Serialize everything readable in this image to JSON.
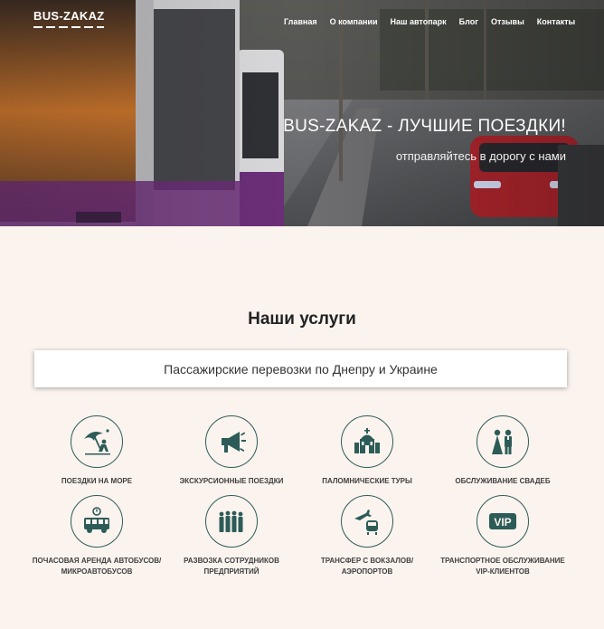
{
  "header": {
    "logo": "BUS-ZAKAZ",
    "nav": [
      "Главная",
      "О компании",
      "Наш автопарк",
      "Блог",
      "Отзывы",
      "Контакты"
    ]
  },
  "hero": {
    "title": "BUS-ZAKAZ - ЛУЧШИЕ ПОЕЗДКИ!",
    "subtitle": "отправляйтесь в дорогу с нами"
  },
  "services": {
    "title": "Наши услуги",
    "banner": "Пассажирские перевозки по Днепру и Украине",
    "items": [
      {
        "label": "ПОЕЗДКИ НА МОРЕ",
        "icon": "beach-umbrella-icon"
      },
      {
        "label": "ЭКСКУРСИОННЫЕ ПОЕЗДКИ",
        "icon": "megaphone-icon"
      },
      {
        "label": "ПАЛОМНИЧЕСКИЕ ТУРЫ",
        "icon": "church-icon"
      },
      {
        "label": "ОБСЛУЖИВАНИЕ СВАДЕБ",
        "icon": "wedding-couple-icon"
      },
      {
        "label": "ПОЧАСОВАЯ АРЕНДА АВТОБУСОВ/ МИКРОАВТОБУСОВ",
        "icon": "bus-clock-icon"
      },
      {
        "label": "РАЗВОЗКА СОТРУДНИКОВ ПРЕДПРИЯТИЙ",
        "icon": "employees-icon"
      },
      {
        "label": "ТРАНСФЕР С ВОКЗАЛОВ/ АЭРОПОРТОВ",
        "icon": "plane-train-icon"
      },
      {
        "label": "ТРАНСПОРТНОЕ ОБСЛУЖИВАНИЕ VIP-КЛИЕНТОВ",
        "icon": "vip-icon"
      }
    ],
    "vip_text": "VIP"
  },
  "colors": {
    "icon": "#2d5c58",
    "background": "#fbf3ee"
  }
}
